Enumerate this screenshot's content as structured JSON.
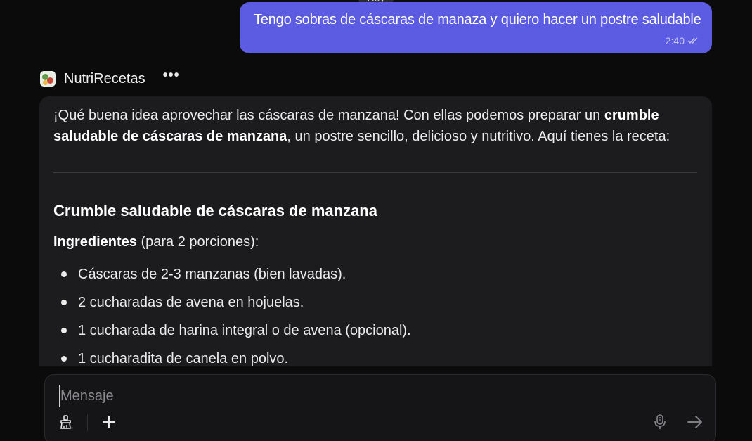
{
  "day_badge": "Hoy",
  "user_message": {
    "text": "Tengo sobras de cáscaras de manaza y quiero hacer un postre saludable",
    "time": "2:40",
    "status_icon": "double-check-icon"
  },
  "bot": {
    "name": "NutriRecetas",
    "menu_label": "•••",
    "intro_part1": "¡Qué buena idea aprovechar las cáscaras de manzana! Con ellas podemos preparar un ",
    "intro_bold": "crumble saludable de cáscaras de manzana",
    "intro_part2": ", un postre sencillo, delicioso y nutritivo. Aquí tienes la receta:",
    "recipe_title": "Crumble saludable de cáscaras de manzana",
    "ingredients_label": "Ingredientes",
    "ingredients_suffix": " (para 2 porciones):",
    "ingredients": [
      "Cáscaras de 2-3 manzanas (bien lavadas).",
      "2 cucharadas de avena en hojuelas.",
      "1 cucharada de harina integral o de avena (opcional).",
      "1 cucharadita de canela en polvo."
    ]
  },
  "composer": {
    "placeholder": "Mensaje",
    "value": "",
    "tools": [
      "brush-icon",
      "plus-icon",
      "microphone-icon",
      "send-arrow-icon"
    ]
  },
  "colors": {
    "background": "#0b0b0b",
    "user_bubble": "#5b5ce1",
    "bot_card": "#1c1c1f"
  }
}
